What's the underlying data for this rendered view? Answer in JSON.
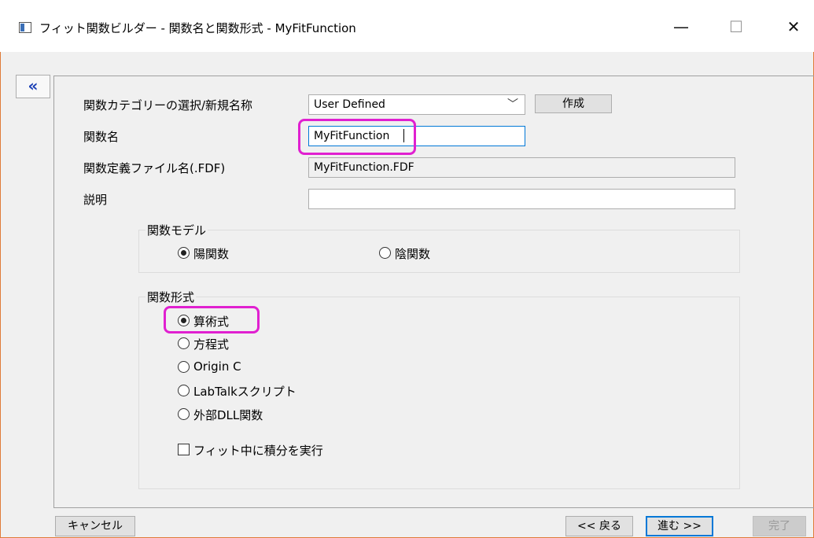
{
  "window": {
    "title": "フィット関数ビルダー - 関数名と関数形式 - MyFitFunction",
    "minimize_glyph": "—",
    "maximize_glyph": "☐",
    "close_glyph": "✕"
  },
  "sidebar_toggle": {
    "glyph": "«"
  },
  "form": {
    "category_label": "関数カテゴリーの選択/新規名称",
    "category_value": "User Defined",
    "create_button": "作成",
    "function_name_label": "関数名",
    "function_name_value": "MyFitFunction",
    "fdf_label": "関数定義ファイル名(.FDF)",
    "fdf_value": "MyFitFunction.FDF",
    "description_label": "説明",
    "description_value": ""
  },
  "model_group": {
    "title": "関数モデル",
    "options": [
      {
        "label": "陽関数",
        "selected": true
      },
      {
        "label": "陰関数",
        "selected": false
      }
    ]
  },
  "form_group": {
    "title": "関数形式",
    "options": [
      {
        "label": "算術式",
        "selected": true
      },
      {
        "label": "方程式",
        "selected": false
      },
      {
        "label": "Origin C",
        "selected": false
      },
      {
        "label": "LabTalkスクリプト",
        "selected": false
      },
      {
        "label": "外部DLL関数",
        "selected": false
      }
    ],
    "integrate_checkbox": {
      "label": "フィット中に積分を実行",
      "checked": false
    }
  },
  "footer": {
    "cancel": "キャンセル",
    "back": "<< 戻る",
    "next": "進む >>",
    "finish": "完了"
  },
  "colors": {
    "highlight": "#e020d0",
    "window_border": "#e07b39",
    "focus_border": "#0078d7"
  }
}
